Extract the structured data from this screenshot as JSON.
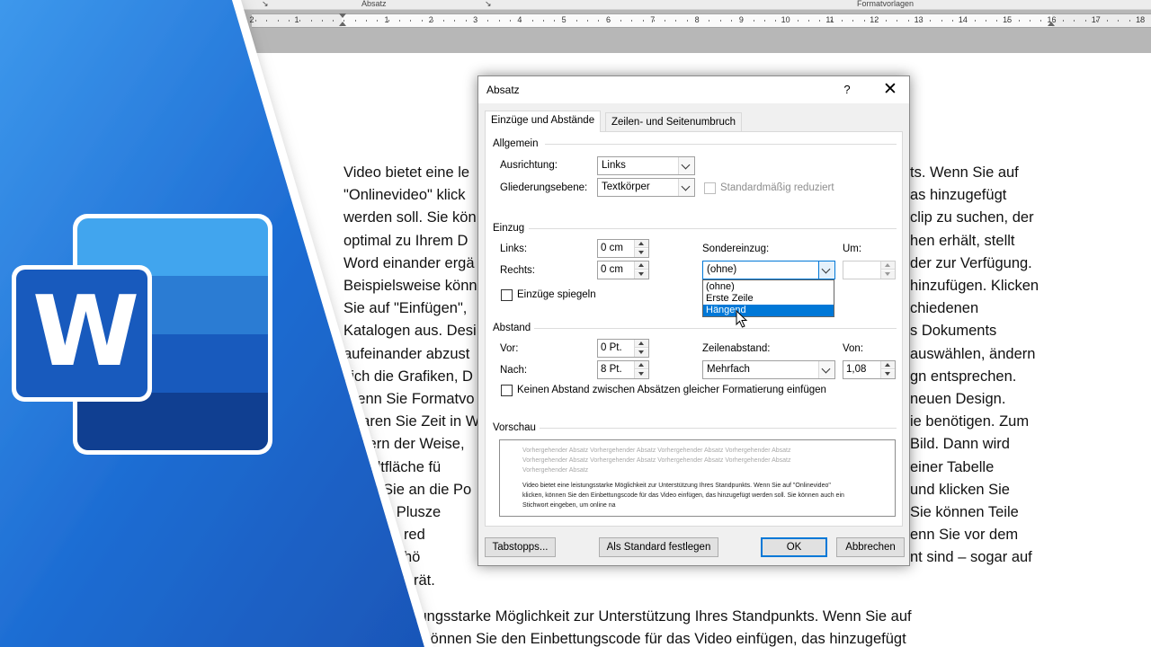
{
  "word": {
    "ribbon_group_paragraph": "Absatz",
    "ribbon_group_styles": "Formatvorlagen",
    "ruler_numbers": [
      "2",
      "1",
      "1",
      "2",
      "3",
      "4",
      "5",
      "6",
      "7",
      "8",
      "9",
      "10",
      "11",
      "12",
      "13",
      "14",
      "15",
      "16",
      "17",
      "18"
    ],
    "doc_lines": [
      "Video bietet eine le",
      "\"Onlinevideo\" klick",
      "werden soll. Sie kön",
      "optimal zu Ihrem D",
      "Word einander ergä",
      "Beispielsweise könn",
      "Sie auf \"Einfügen\",",
      "Katalogen aus. Desi",
      "aufeinander abzust",
      "sich die Grafiken, D",
      "Wenn Sie Formatvo",
      "Sparen Sie Zeit in W",
      "ändern der Weise,",
      "Schaltfläche fü",
      "ichen Sie an die Po",
      "auf das Plusze",
      "kuments red",
      "lesen aufhö",
      "nderen Gerät."
    ],
    "doc_lines_right": [
      "ts. Wenn Sie auf",
      "as hinzugefügt",
      "clip zu suchen, der",
      "hen erhält, stellt",
      "der zur Verfügung.",
      "hinzufügen. Klicken",
      "chiedenen",
      "s Dokuments",
      "auswählen, ändern",
      "gn entsprechen.",
      "neuen Design.",
      "ie benötigen. Zum",
      "Bild. Dann wird",
      "einer Tabelle",
      "und klicken Sie",
      "Sie können Teile",
      "enn Sie vor dem",
      "nt sind – sogar auf"
    ],
    "doc_bottom_lines": [
      "et eine leistungsstarke Möglichkeit zur Unterstützung Ihres Standpunkts. Wenn Sie auf",
      "eo\" klicken, können Sie den Einbettungscode für das Video einfügen, das hinzugefügt"
    ],
    "logo_letter": "W",
    "brand_colors": {
      "blue_dark": "#185abd",
      "blue_mid": "#2b7cd3",
      "blue_light": "#41a5ee",
      "panel": "#1e6fd0"
    }
  },
  "dialog": {
    "title": "Absatz",
    "help_label": "?",
    "close_label": "✕",
    "tabs": [
      {
        "label": "Einzüge und Abstände",
        "active": true
      },
      {
        "label": "Zeilen- und Seitenumbruch",
        "active": false
      }
    ],
    "general": {
      "heading": "Allgemein",
      "alignment_label": "Ausrichtung:",
      "alignment_value": "Links",
      "outline_label": "Gliederungsebene:",
      "outline_value": "Textkörper",
      "collapsed_label": "Standardmäßig reduziert"
    },
    "indent": {
      "heading": "Einzug",
      "left_label": "Links:",
      "left_value": "0 cm",
      "right_label": "Rechts:",
      "right_value": "0 cm",
      "special_label": "Sondereinzug:",
      "special_value": "(ohne)",
      "by_label": "Um:",
      "by_value": "",
      "mirror_label": "Einzüge spiegeln",
      "special_options": [
        "(ohne)",
        "Erste Zeile",
        "Hängend"
      ],
      "highlighted_option": "Hängend"
    },
    "spacing": {
      "heading": "Abstand",
      "before_label": "Vor:",
      "before_value": "0 Pt.",
      "after_label": "Nach:",
      "after_value": "8 Pt.",
      "line_label": "Zeilenabstand:",
      "line_value": "Mehrfach",
      "at_label": "Von:",
      "at_value": "1,08",
      "no_space_label": "Keinen Abstand zwischen Absätzen gleicher Formatierung einfügen"
    },
    "preview": {
      "heading": "Vorschau",
      "prev_lines": [
        "Vorhergehender Absatz Vorhergehender Absatz Vorhergehender Absatz Vorhergehender Absatz",
        "Vorhergehender Absatz Vorhergehender Absatz Vorhergehender Absatz Vorhergehender Absatz",
        "Vorhergehender Absatz"
      ],
      "body_lines": [
        "Video bietet eine leistungsstarke Möglichkeit zur Unterstützung Ihres Standpunkts. Wenn Sie auf \"Onlinevideo\"",
        "klicken, können Sie den Einbettungscode für das Video einfügen, das hinzugefügt werden soll. Sie können auch ein",
        "Stichwort eingeben, um online na"
      ]
    },
    "buttons": {
      "tabs": "Tabstopps...",
      "default": "Als Standard festlegen",
      "ok": "OK",
      "cancel": "Abbrechen"
    }
  }
}
